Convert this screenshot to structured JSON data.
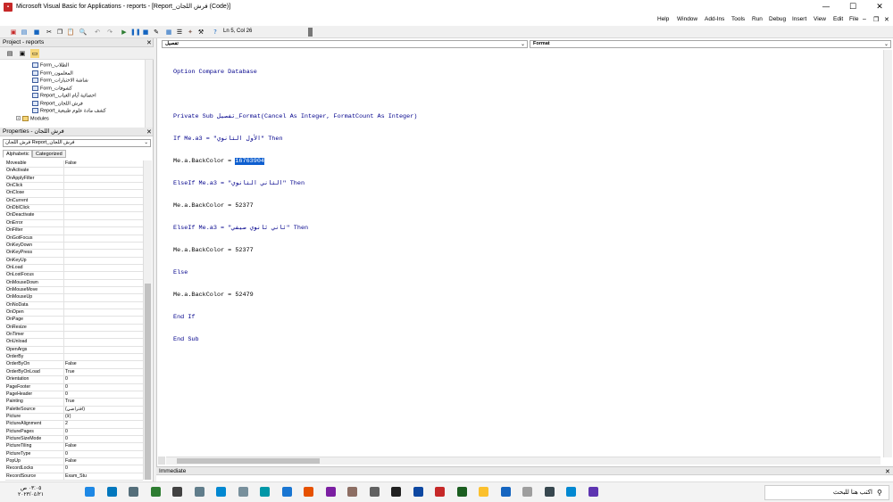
{
  "window": {
    "title": "Microsoft Visual Basic for Applications - reports - [Report_فرش اللجان (Code)]",
    "minimize": "—",
    "maximize": "☐",
    "close": "✕"
  },
  "menu": [
    "Help",
    "Window",
    "Add-Ins",
    "Tools",
    "Run",
    "Debug",
    "Insert",
    "View",
    "Edit",
    "File"
  ],
  "toolbar": {
    "status": "Ln 5, Col 26"
  },
  "project": {
    "title": "Project - reports",
    "items": [
      {
        "label": "Form_الطلاب",
        "type": "form"
      },
      {
        "label": "Form_المعلمون",
        "type": "form"
      },
      {
        "label": "Form_شاشة الاختبارات",
        "type": "form"
      },
      {
        "label": "Form_كشوفات",
        "type": "form"
      },
      {
        "label": "Report_احصائية أيام الغياب",
        "type": "report"
      },
      {
        "label": "Report_فرش اللجان",
        "type": "report"
      },
      {
        "label": "Report_كشف مادة علوم طبيعية",
        "type": "report"
      },
      {
        "label": "Modules",
        "type": "folder"
      }
    ]
  },
  "properties": {
    "title": "Properties - فرش اللجان",
    "object": "فرش اللجان Report_فرش اللجان",
    "tabs": [
      "Alphabetic",
      "Categorized"
    ],
    "rows": [
      [
        "Moveable",
        "False"
      ],
      [
        "OnActivate",
        ""
      ],
      [
        "OnApplyFilter",
        ""
      ],
      [
        "OnClick",
        ""
      ],
      [
        "OnClose",
        ""
      ],
      [
        "OnCurrent",
        ""
      ],
      [
        "OnDblClick",
        ""
      ],
      [
        "OnDeactivate",
        ""
      ],
      [
        "OnError",
        ""
      ],
      [
        "OnFilter",
        ""
      ],
      [
        "OnGotFocus",
        ""
      ],
      [
        "OnKeyDown",
        ""
      ],
      [
        "OnKeyPress",
        ""
      ],
      [
        "OnKeyUp",
        ""
      ],
      [
        "OnLoad",
        ""
      ],
      [
        "OnLostFocus",
        ""
      ],
      [
        "OnMouseDown",
        ""
      ],
      [
        "OnMouseMove",
        ""
      ],
      [
        "OnMouseUp",
        ""
      ],
      [
        "OnNoData",
        ""
      ],
      [
        "OnOpen",
        ""
      ],
      [
        "OnPage",
        ""
      ],
      [
        "OnResize",
        ""
      ],
      [
        "OnTimer",
        ""
      ],
      [
        "OnUnload",
        ""
      ],
      [
        "OpenArgs",
        ""
      ],
      [
        "OrderBy",
        ""
      ],
      [
        "OrderByOn",
        "False"
      ],
      [
        "OrderByOnLoad",
        "True"
      ],
      [
        "Orientation",
        "0"
      ],
      [
        "PageFooter",
        "0"
      ],
      [
        "PageHeader",
        "0"
      ],
      [
        "Painting",
        "True"
      ],
      [
        "PaletteSource",
        "(افتراضي)"
      ],
      [
        "Picture",
        "(لا)"
      ],
      [
        "PictureAlignment",
        "2"
      ],
      [
        "PicturePages",
        "0"
      ],
      [
        "PictureSizeMode",
        "0"
      ],
      [
        "PictureTiling",
        "False"
      ],
      [
        "PictureType",
        "0"
      ],
      [
        "PopUp",
        "False"
      ],
      [
        "RecordLocks",
        "0"
      ],
      [
        "RecordSource",
        "Exam_Stu"
      ]
    ]
  },
  "code": {
    "object_combo": "تفصيل",
    "procedure_combo": "Format",
    "lines": [
      "Option Compare Database",
      "",
      "Private Sub تفصيل_Format(Cancel As Integer, FormatCount As Integer)",
      "If Me.a3 = \"الأول الثانوي\" Then",
      "Me.a.BackColor = ",
      "ElseIf Me.a3 = \"الثاني الثانوي\" Then",
      "Me.a.BackColor = 52377",
      "ElseIf Me.a3 = \"ثاني ثانوي صيفي\" Then",
      "Me.a.BackColor = 52377",
      "Else",
      "Me.a.BackColor = 52479",
      "End If",
      "End Sub"
    ],
    "selected_value": "16763904"
  },
  "immediate": {
    "title": "Immediate"
  },
  "taskbar": {
    "search_placeholder": "اكتب هنا للبحث",
    "time": "٠٣:٠٥ ص",
    "date": "٢٠٢٣/٠٤/٢١",
    "apps": [
      {
        "name": "app-icon",
        "color": "#1e88e5"
      },
      {
        "name": "app-icon",
        "color": "#0277bd"
      },
      {
        "name": "app-icon",
        "color": "#546e7a"
      },
      {
        "name": "app-icon",
        "color": "#2e7d32"
      },
      {
        "name": "app-icon",
        "color": "#424242"
      },
      {
        "name": "app-icon",
        "color": "#607d8b"
      },
      {
        "name": "app-icon",
        "color": "#0288d1"
      },
      {
        "name": "app-icon",
        "color": "#78909c"
      },
      {
        "name": "app-icon",
        "color": "#0097a7"
      },
      {
        "name": "app-icon",
        "color": "#1976d2"
      },
      {
        "name": "app-icon",
        "color": "#e65100"
      },
      {
        "name": "app-icon",
        "color": "#7b1fa2"
      },
      {
        "name": "app-icon",
        "color": "#8d6e63"
      },
      {
        "name": "app-icon",
        "color": "#616161"
      },
      {
        "name": "app-icon",
        "color": "#212121"
      },
      {
        "name": "app-icon",
        "color": "#0d47a1"
      },
      {
        "name": "app-icon",
        "color": "#c62828"
      },
      {
        "name": "app-icon",
        "color": "#1b5e20"
      },
      {
        "name": "app-icon",
        "color": "#fbc02d"
      },
      {
        "name": "app-icon",
        "color": "#1565c0"
      },
      {
        "name": "app-icon",
        "color": "#9e9e9e"
      },
      {
        "name": "app-icon",
        "color": "#37474f"
      },
      {
        "name": "app-icon",
        "color": "#0288d1"
      },
      {
        "name": "app-icon",
        "color": "#5e35b1"
      }
    ]
  }
}
